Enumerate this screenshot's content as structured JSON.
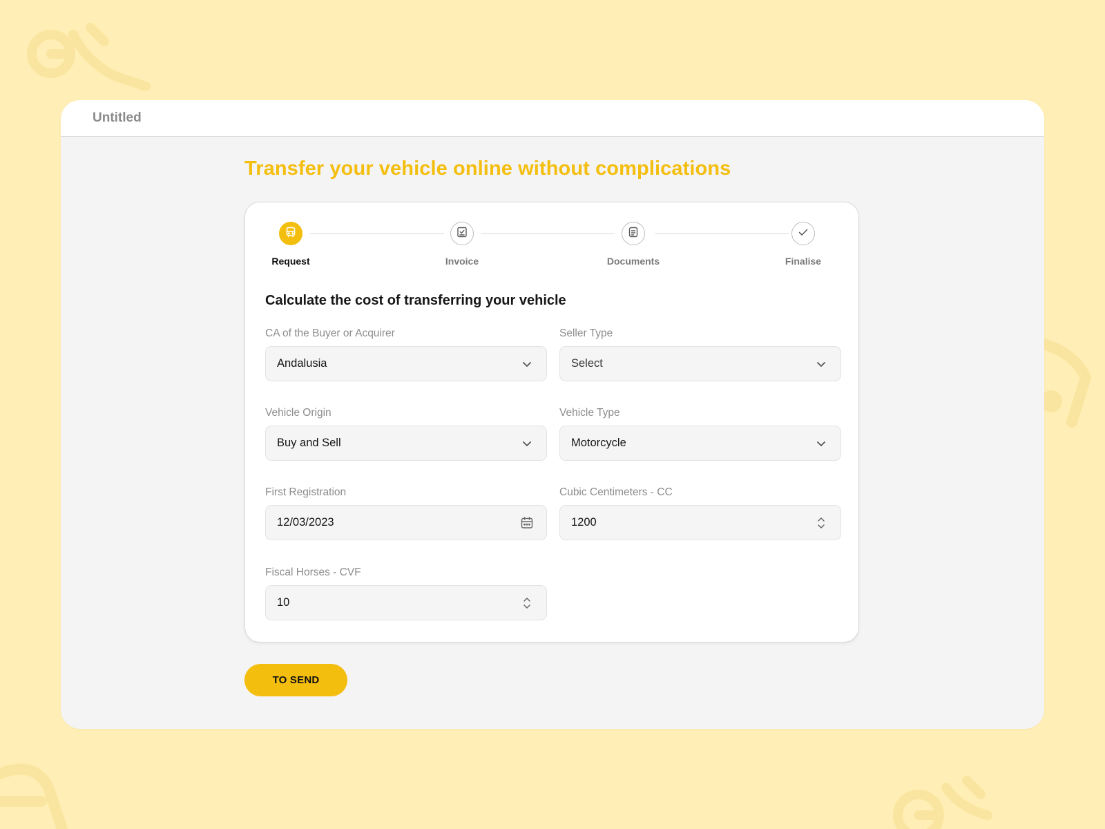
{
  "window": {
    "title": "Untitled"
  },
  "page": {
    "heading": "Transfer your vehicle online without complications"
  },
  "colors": {
    "accent": "#F4BE0F",
    "background": "#FFEEB5",
    "panel": "#F4F4F4"
  },
  "stepper": {
    "steps": [
      {
        "label": "Request",
        "icon": "car-icon",
        "active": true
      },
      {
        "label": "Invoice",
        "icon": "invoice-check-icon",
        "active": false
      },
      {
        "label": "Documents",
        "icon": "document-icon",
        "active": false
      },
      {
        "label": "Finalise",
        "icon": "checkmark-icon",
        "active": false
      }
    ]
  },
  "form": {
    "title": "Calculate the cost of transferring your vehicle",
    "buyer_ca": {
      "label": "CA of the Buyer or Acquirer",
      "value": "Andalusia",
      "icon": "chevron-down-icon"
    },
    "seller_type": {
      "label": "Seller Type",
      "value": "Select",
      "icon": "chevron-down-icon"
    },
    "vehicle_origin": {
      "label": "Vehicle Origin",
      "value": "Buy and Sell",
      "icon": "chevron-down-icon"
    },
    "vehicle_type": {
      "label": "Vehicle Type",
      "value": "Motorcycle",
      "icon": "chevron-down-icon"
    },
    "first_registration": {
      "label": "First Registration",
      "value": "12/03/2023",
      "icon": "calendar-icon"
    },
    "cubic_centimeters": {
      "label": "Cubic Centimeters - CC",
      "value": "1200",
      "icon": "stepper-arrows-icon"
    },
    "fiscal_horses": {
      "label": "Fiscal Horses - CVF",
      "value": "10",
      "icon": "stepper-arrows-icon"
    }
  },
  "actions": {
    "send_label": "TO SEND"
  }
}
